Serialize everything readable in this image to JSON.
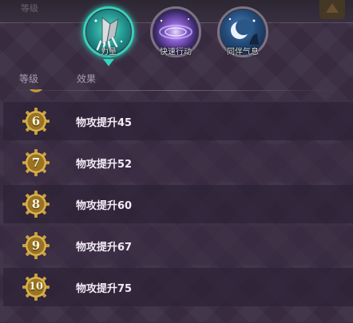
{
  "top_hint": "等级",
  "tabs": [
    {
      "label": "力量",
      "active": true,
      "icon": "claw-icon"
    },
    {
      "label": "快速行动",
      "active": false,
      "icon": "vortex-icon"
    },
    {
      "label": "同伴气息",
      "active": false,
      "icon": "moon-icon"
    }
  ],
  "headers": {
    "level": "等级",
    "effect": "效果"
  },
  "rows": [
    {
      "level": "6",
      "effect": "物攻提升45"
    },
    {
      "level": "7",
      "effect": "物攻提升52"
    },
    {
      "level": "8",
      "effect": "物攻提升60"
    },
    {
      "level": "9",
      "effect": "物攻提升67"
    },
    {
      "level": "10",
      "effect": "物攻提升75"
    }
  ],
  "colors": {
    "active_ring": "#35d2b9",
    "gear": "#c49a3a",
    "panel": "#3a2d43"
  }
}
